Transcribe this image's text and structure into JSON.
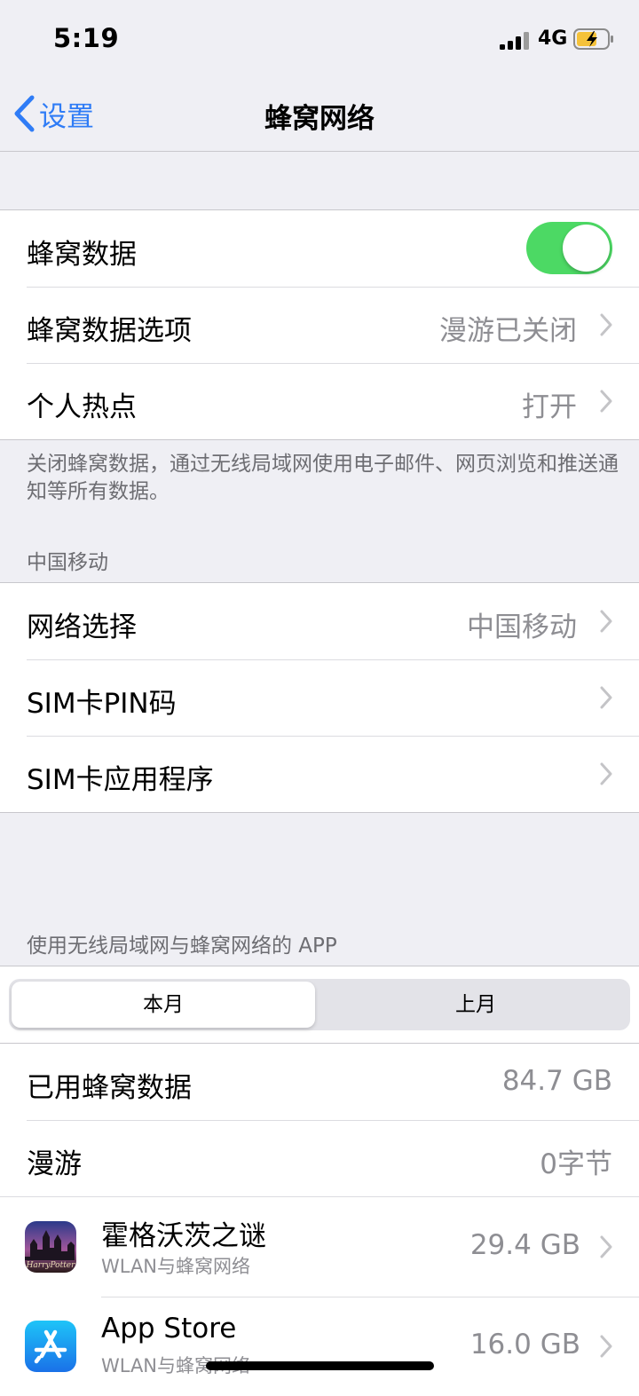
{
  "status_bar": {
    "time": "5:19",
    "network": "4G",
    "signal_icon": "cellular-signal-icon",
    "battery_icon": "battery-charging-icon"
  },
  "nav": {
    "back_label": "设置",
    "title": "蜂窝网络",
    "back_icon": "chevron-left-icon"
  },
  "cellular_group": {
    "rows": [
      {
        "label": "蜂窝数据",
        "toggle_on": true
      },
      {
        "label": "蜂窝数据选项",
        "value": "漫游已关闭"
      },
      {
        "label": "个人热点",
        "value": "打开"
      }
    ],
    "footer": "关闭蜂窝数据，通过无线局域网使用电子邮件、网页浏览和推送通知等所有数据。"
  },
  "carrier_section": {
    "header": "中国移动",
    "rows": [
      {
        "label": "网络选择",
        "value": "中国移动"
      },
      {
        "label": "SIM卡PIN码",
        "value": ""
      },
      {
        "label": "SIM卡应用程序",
        "value": ""
      }
    ]
  },
  "usage_section": {
    "header": "使用无线局域网与蜂窝网络的 APP",
    "segments": [
      "本月",
      "上月"
    ],
    "selected_segment": "本月",
    "rows": [
      {
        "label": "已用蜂窝数据",
        "value": "84.7 GB"
      },
      {
        "label": "漫游",
        "value": "0字节"
      }
    ],
    "apps": [
      {
        "name": "霍格沃茨之谜",
        "subtitle": "WLAN与蜂窝网络",
        "value": "29.4 GB",
        "icon": "hogwarts-legacy-icon",
        "icon_text": "HarryPotter"
      },
      {
        "name": "App Store",
        "subtitle": "WLAN与蜂窝网络",
        "value": "16.0 GB",
        "icon": "app-store-icon"
      }
    ]
  },
  "colors": {
    "accent": "#2f7cf6",
    "toggle_on": "#4cd964",
    "background": "#efeff4",
    "secondary_text": "#8e8e93"
  }
}
